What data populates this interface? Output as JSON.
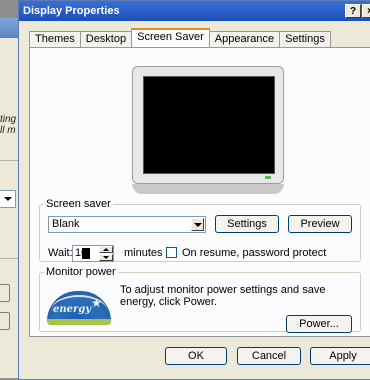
{
  "background_window": {
    "text_lines": [
      "ting",
      "ll m"
    ]
  },
  "dialog": {
    "title": "Display Properties",
    "help_label": "?",
    "close_label": "×",
    "tabs": [
      {
        "label": "Themes",
        "active": false
      },
      {
        "label": "Desktop",
        "active": false
      },
      {
        "label": "Screen Saver",
        "active": true
      },
      {
        "label": "Appearance",
        "active": false
      },
      {
        "label": "Settings",
        "active": false
      }
    ],
    "screen_saver": {
      "group_label": "Screen saver",
      "selected": "Blank",
      "settings_button": "Settings",
      "preview_button": "Preview",
      "wait_label": "Wait:",
      "wait_value": "10",
      "minutes_label": "minutes",
      "password_label": "On resume, password protect",
      "password_checked": false
    },
    "monitor_power": {
      "group_label": "Monitor power",
      "description": "To adjust monitor power settings and save energy, click Power.",
      "power_button": "Power...",
      "logo_text": "energy"
    },
    "buttons": {
      "ok": "OK",
      "cancel": "Cancel",
      "apply": "Apply"
    }
  },
  "colors": {
    "title_bar": "#1c4fb8",
    "dialog_bg": "#ece9d8",
    "active_tab_accent": "#e68b2c"
  }
}
